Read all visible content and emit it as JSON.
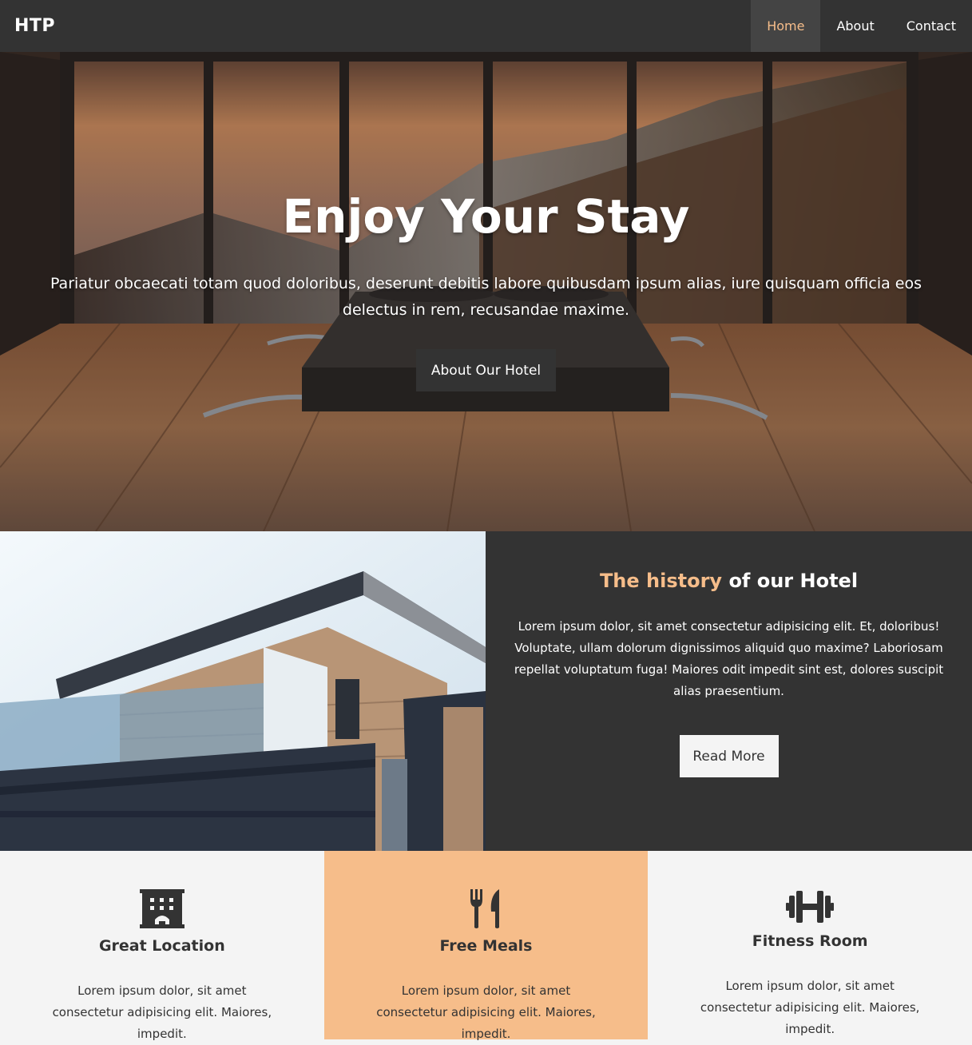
{
  "nav": {
    "brand": "HTP",
    "links": [
      {
        "label": "Home",
        "active": true
      },
      {
        "label": "About",
        "active": false
      },
      {
        "label": "Contact",
        "active": false
      }
    ]
  },
  "hero": {
    "title": "Enjoy Your Stay",
    "text": "Pariatur obcaecati totam quod doloribus, deserunt debitis labore quibusdam ipsum alias, iure quisquam officia eos delectus in rem, recusandae maxime.",
    "button_label": "About Our Hotel"
  },
  "history": {
    "title_accent": "The history",
    "title_rest": "of our Hotel",
    "text": "Lorem ipsum dolor, sit amet consectetur adipisicing elit. Et, doloribus! Voluptate, ullam dolorum dignissimos aliquid quo maxime? Laboriosam repellat voluptatum fuga! Maiores odit impedit sint est, dolores suscipit alias praesentium.",
    "button_label": "Read More"
  },
  "features": [
    {
      "icon": "hotel-icon",
      "title": "Great Location",
      "text": "Lorem ipsum dolor, sit amet consectetur adipisicing elit. Maiores, impedit."
    },
    {
      "icon": "utensils-icon",
      "title": "Free Meals",
      "text": "Lorem ipsum dolor, sit amet consectetur adipisicing elit. Maiores, impedit."
    },
    {
      "icon": "dumbbell-icon",
      "title": "Fitness Room",
      "text": "Lorem ipsum dolor, sit amet consectetur adipisicing elit. Maiores, impedit."
    }
  ],
  "colors": {
    "dark": "#333333",
    "accent": "#f6bd8a",
    "light": "#f4f4f4"
  }
}
